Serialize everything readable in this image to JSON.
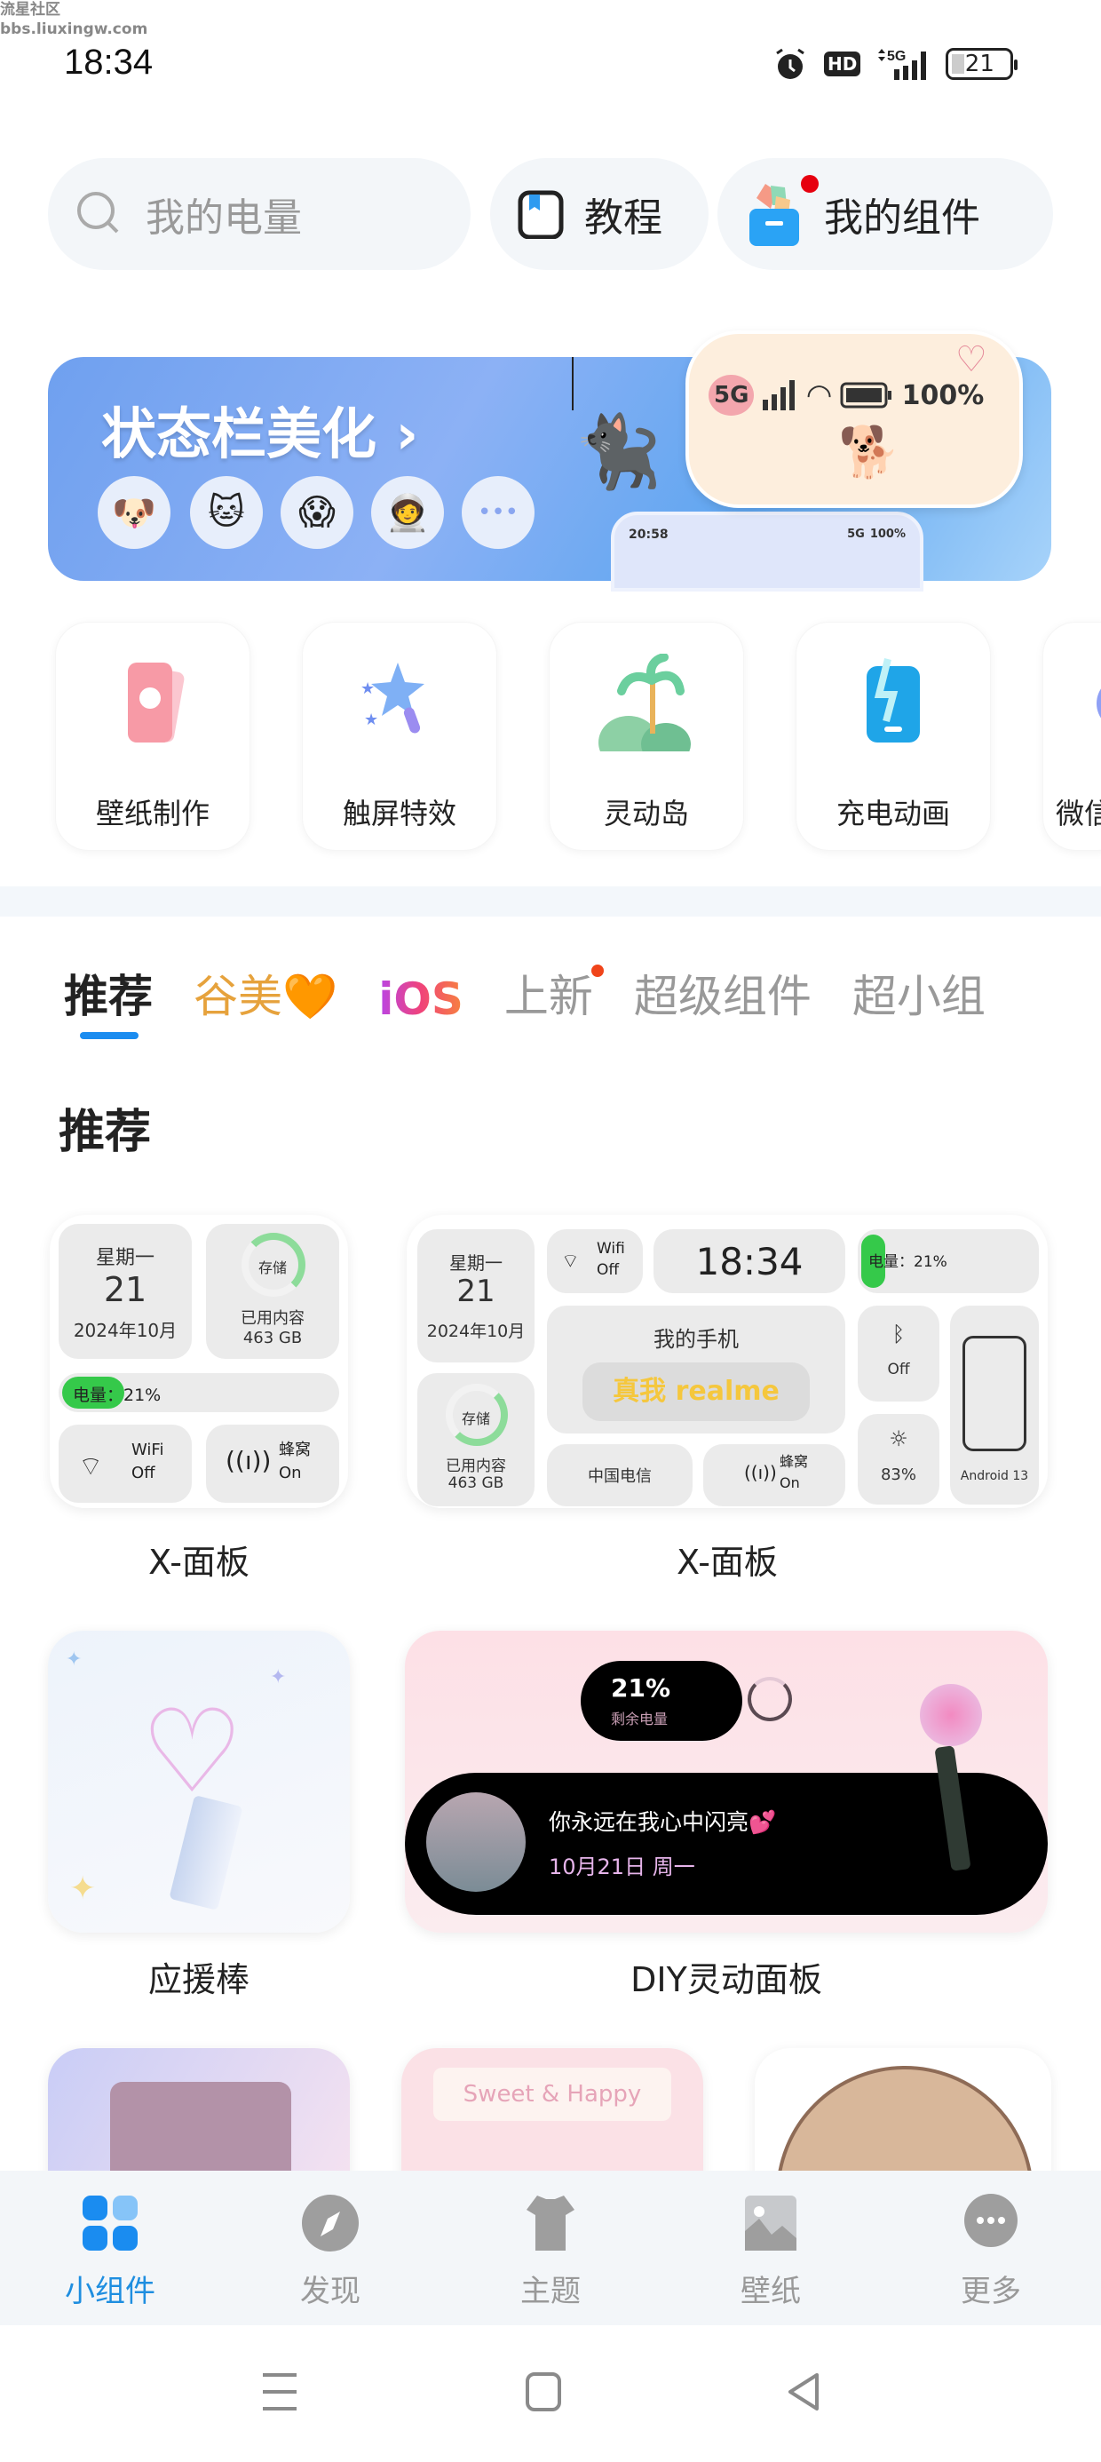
{
  "watermark": {
    "line1": "流星社区",
    "line2": "bbs.liuxingw.com"
  },
  "status_bar": {
    "time": "18:34",
    "hd": "HD",
    "network": "5G",
    "battery": "21"
  },
  "header": {
    "search_placeholder": "我的电量",
    "tutorial_label": "教程",
    "my_widgets_label": "我的组件"
  },
  "banner": {
    "title": "状态栏美化 ›",
    "preview_network": "5G",
    "preview_battery": "100%",
    "mini_time": "20:58",
    "mini_network": "5G",
    "mini_battery": "100%",
    "more_label": "•••"
  },
  "quick_entries": [
    {
      "label": "壁纸制作"
    },
    {
      "label": "触屏特效"
    },
    {
      "label": "灵动岛"
    },
    {
      "label": "充电动画"
    },
    {
      "label": "微信"
    }
  ],
  "tabs": [
    {
      "label": "推荐",
      "active": true
    },
    {
      "label": "谷美🧡"
    },
    {
      "label": "iOS"
    },
    {
      "label": "上新",
      "badge": true
    },
    {
      "label": "超级组件"
    },
    {
      "label": "超小组"
    }
  ],
  "section_title": "推荐",
  "widget1": {
    "weekday": "星期一",
    "day": "21",
    "month": "2024年10月",
    "storage_label": "存储",
    "storage_used_label": "已用内容",
    "storage_value": "463 GB",
    "battery_label": "电量：21%",
    "battery_percent": 21,
    "wifi_label": "WiFi",
    "wifi_state": "Off",
    "cell_label": "蜂窝",
    "cell_state": "On",
    "name": "X-面板"
  },
  "widget2": {
    "weekday": "星期一",
    "day": "21",
    "month": "2024年10月",
    "wifi_label": "Wifi",
    "wifi_state": "Off",
    "time": "18:34",
    "battery_label": "电量：21%",
    "battery_percent": 21,
    "phone_label": "我的手机",
    "brand": "真我 realme",
    "bt_state": "Off",
    "storage_label": "存储",
    "storage_used_label": "已用内容",
    "storage_value": "463 GB",
    "carrier": "中国电信",
    "cell_label": "蜂窝",
    "cell_state": "On",
    "brightness": "83%",
    "android": "Android 13",
    "name": "X-面板"
  },
  "widget3": {
    "name": "应援棒"
  },
  "widget4": {
    "battery": "21%",
    "battery_label": "剩余电量",
    "message": "你永远在我心中闪亮💕",
    "date": "10月21日 周一",
    "name": "DIY灵动面板"
  },
  "widget5": {
    "text": "Sweet & Happy"
  },
  "bottom_nav": [
    {
      "label": "小组件",
      "active": true
    },
    {
      "label": "发现"
    },
    {
      "label": "主题"
    },
    {
      "label": "壁纸"
    },
    {
      "label": "更多"
    }
  ]
}
